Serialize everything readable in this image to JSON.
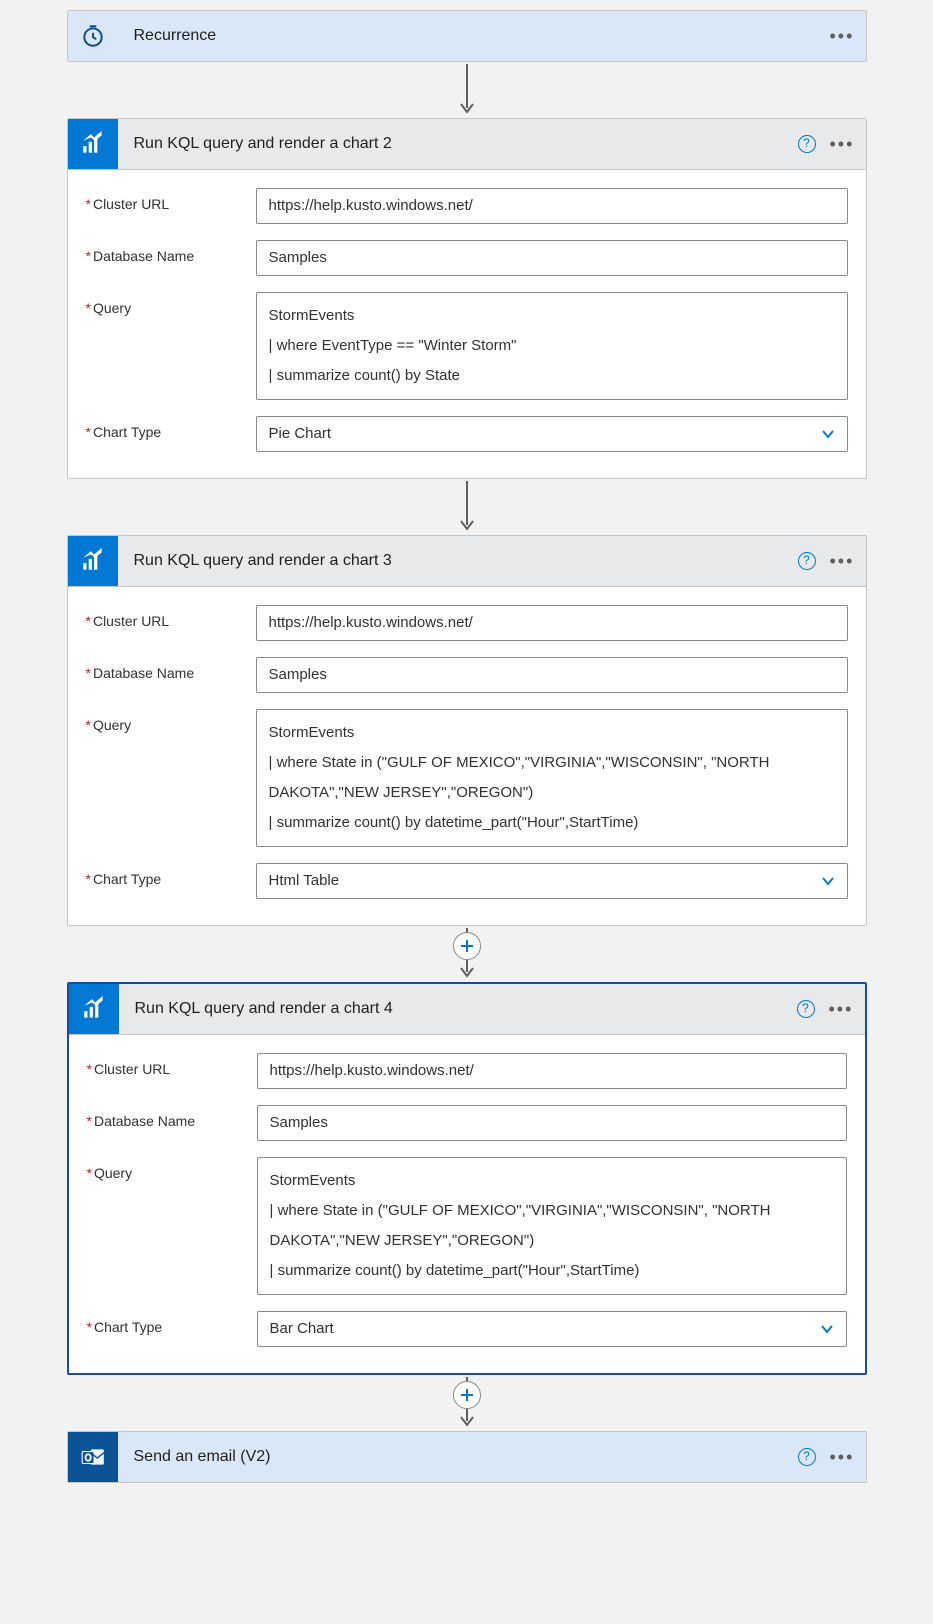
{
  "trigger": {
    "title": "Recurrence"
  },
  "actions": [
    {
      "title": "Run KQL query and render a chart 2",
      "fields": {
        "clusterUrl": {
          "label": "Cluster URL",
          "value": "https://help.kusto.windows.net/"
        },
        "databaseName": {
          "label": "Database Name",
          "value": "Samples"
        },
        "query": {
          "label": "Query",
          "value": "StormEvents\n| where EventType == \"Winter Storm\"\n| summarize count() by State"
        },
        "chartType": {
          "label": "Chart Type",
          "value": "Pie Chart"
        }
      },
      "selected": false,
      "showAdd": false
    },
    {
      "title": "Run KQL query and render a chart 3",
      "fields": {
        "clusterUrl": {
          "label": "Cluster URL",
          "value": "https://help.kusto.windows.net/"
        },
        "databaseName": {
          "label": "Database Name",
          "value": "Samples"
        },
        "query": {
          "label": "Query",
          "value": "StormEvents\n| where State in (\"GULF OF MEXICO\",\"VIRGINIA\",\"WISCONSIN\", \"NORTH DAKOTA\",\"NEW JERSEY\",\"OREGON\")\n| summarize count() by datetime_part(\"Hour\",StartTime)"
        },
        "chartType": {
          "label": "Chart Type",
          "value": "Html Table"
        }
      },
      "selected": false,
      "showAdd": true
    },
    {
      "title": "Run KQL query and render a chart 4",
      "fields": {
        "clusterUrl": {
          "label": "Cluster URL",
          "value": "https://help.kusto.windows.net/"
        },
        "databaseName": {
          "label": "Database Name",
          "value": "Samples"
        },
        "query": {
          "label": "Query",
          "value": "StormEvents\n| where State in (\"GULF OF MEXICO\",\"VIRGINIA\",\"WISCONSIN\", \"NORTH DAKOTA\",\"NEW JERSEY\",\"OREGON\")\n| summarize count() by datetime_part(\"Hour\",StartTime)"
        },
        "chartType": {
          "label": "Chart Type",
          "value": "Bar Chart"
        }
      },
      "selected": true,
      "showAdd": true
    }
  ],
  "finalAction": {
    "title": "Send an email (V2)"
  }
}
